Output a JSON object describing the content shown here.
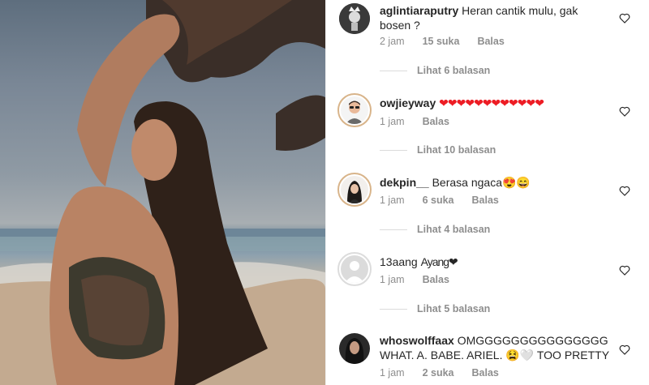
{
  "comments": [
    {
      "username": "aglintiaraputry",
      "text": "Heran cantik mulu, gak bosen ?",
      "time": "2 jam",
      "likes": "15 suka",
      "reply": "Balas",
      "view_replies": "Lihat 6 balasan"
    },
    {
      "username": "owjieyway",
      "text": "❤❤❤❤❤❤❤❤❤❤❤❤",
      "time": "1 jam",
      "reply": "Balas",
      "view_replies": "Lihat 10 balasan"
    },
    {
      "username": "dekpin__",
      "text": "Berasa ngaca😍😄",
      "time": "1 jam",
      "likes": "6 suka",
      "reply": "Balas",
      "view_replies": "Lihat 4 balasan"
    },
    {
      "username": "13aang",
      "text": "Ayang❤",
      "time": "1 jam",
      "reply": "Balas",
      "view_replies": "Lihat 5 balasan"
    },
    {
      "username": "whoswolffaax",
      "text": "OMGGGGGGGGGGGGGGG WHAT. A. BABE. ARIEL. 😫🤍 TOO PRETTY",
      "time": "1 jam",
      "likes": "2 suka",
      "reply": "Balas"
    }
  ],
  "colors": {
    "text": "#262626",
    "meta": "#8e8e8e",
    "heart_red": "#ed1c24",
    "divider": "#dbdbdb"
  },
  "icons": {
    "like": "heart-outline-icon"
  }
}
